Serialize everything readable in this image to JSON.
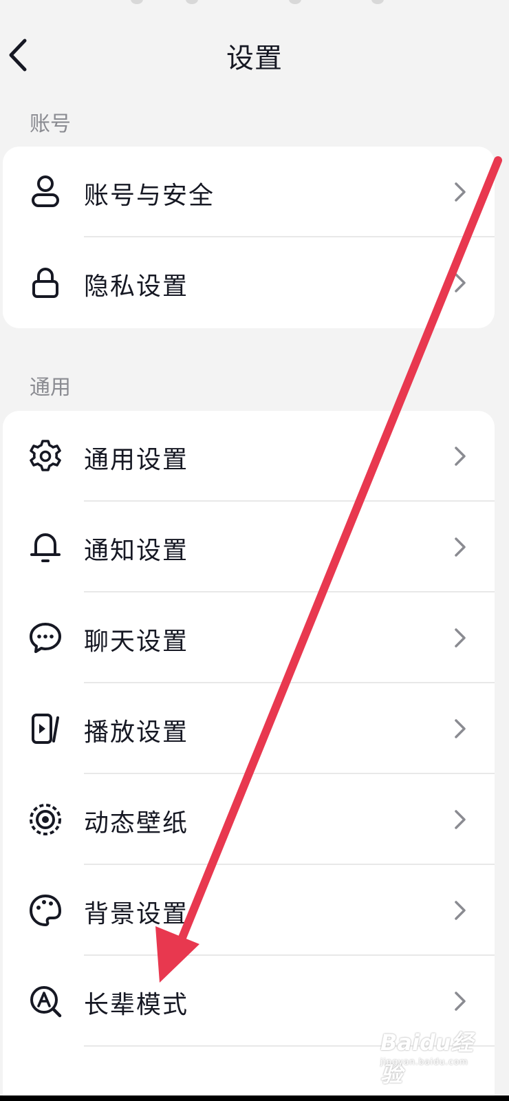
{
  "header": {
    "title": "设置",
    "back_icon": "chevron-left-icon"
  },
  "sections": [
    {
      "label": "账号",
      "items": [
        {
          "label": "账号与安全",
          "icon": "user-icon"
        },
        {
          "label": "隐私设置",
          "icon": "lock-icon"
        }
      ]
    },
    {
      "label": "通用",
      "items": [
        {
          "label": "通用设置",
          "icon": "gear-icon"
        },
        {
          "label": "通知设置",
          "icon": "bell-icon"
        },
        {
          "label": "聊天设置",
          "icon": "chat-bubble-icon"
        },
        {
          "label": "播放设置",
          "icon": "play-screen-icon"
        },
        {
          "label": "动态壁纸",
          "icon": "dynamic-wallpaper-icon"
        },
        {
          "label": "背景设置",
          "icon": "palette-icon"
        },
        {
          "label": "长辈模式",
          "icon": "elder-mode-icon"
        }
      ]
    }
  ],
  "row_chevron_icon": "chevron-right-icon",
  "annotation": {
    "color": "#e8384f"
  },
  "watermark": {
    "main": "Baidu经验",
    "sub": "jingyan.baidu.com"
  }
}
